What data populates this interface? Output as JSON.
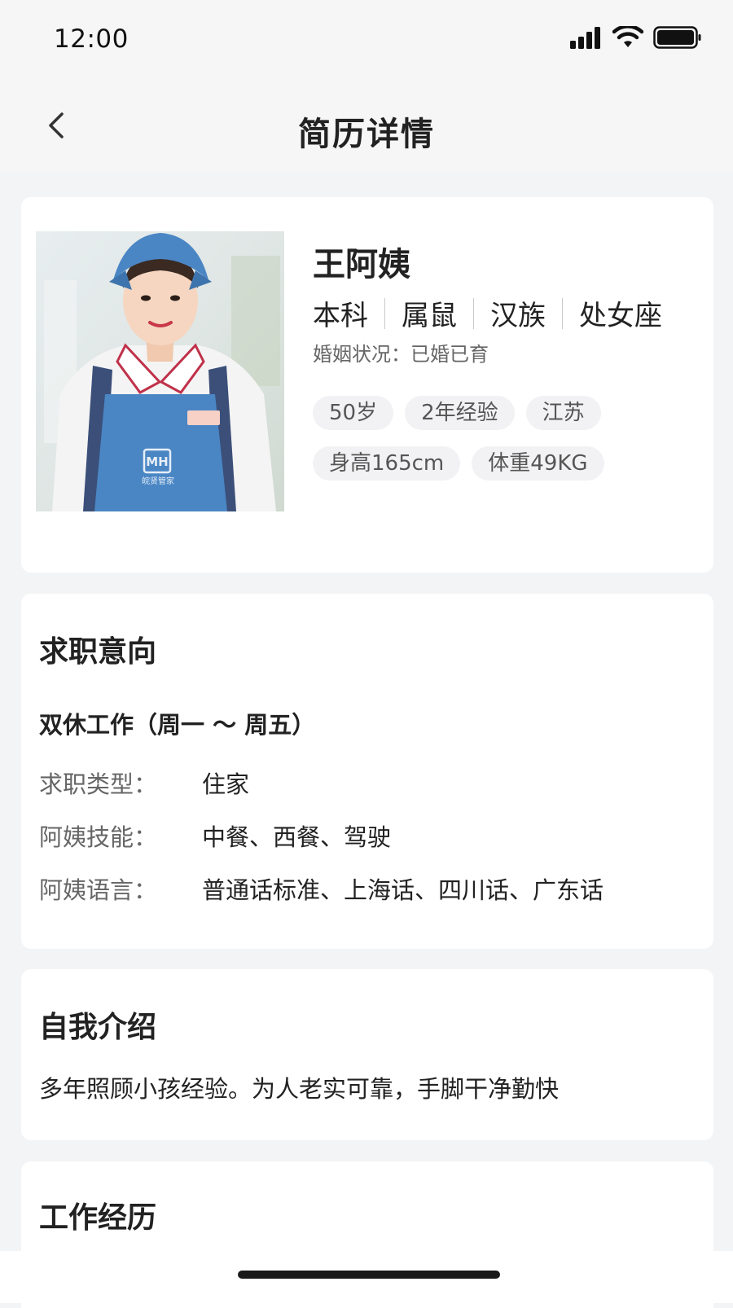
{
  "status": {
    "time": "12:00"
  },
  "nav": {
    "title": "简历详情"
  },
  "profile": {
    "name": "王阿姨",
    "tags": [
      "本科",
      "属鼠",
      "汉族",
      "处女座"
    ],
    "marital_label": "婚姻状况：",
    "marital_value": "已婚已育",
    "chips": [
      "50岁",
      "2年经验",
      "江苏",
      "身高165cm",
      "体重49KG"
    ],
    "photo_logo_text": "MH",
    "photo_apron_text": "皖贤管家"
  },
  "intent": {
    "title": "求职意向",
    "work_mode": "双休工作（周一 ～ 周五）",
    "rows": [
      {
        "label": "求职类型：",
        "value": "住家"
      },
      {
        "label": "阿姨技能：",
        "value": "中餐、西餐、驾驶"
      },
      {
        "label": "阿姨语言：",
        "value": "普通话标准、上海话、四川话、广东话"
      }
    ]
  },
  "intro": {
    "title": "自我介绍",
    "text": "多年照顾小孩经验。为人老实可靠，手脚干净勤快"
  },
  "work": {
    "title": "工作经历"
  },
  "icons": [
    "signal-icon",
    "wifi-icon",
    "battery-icon",
    "back-arrow-icon"
  ]
}
